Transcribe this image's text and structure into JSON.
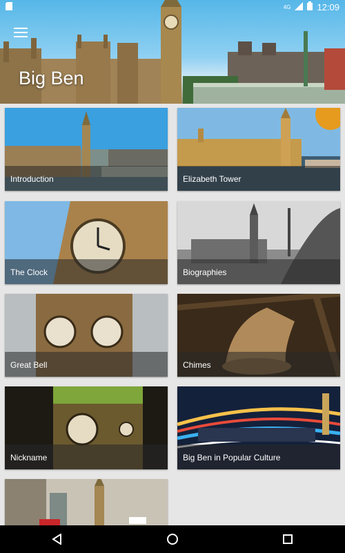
{
  "status": {
    "time": "12:09",
    "network": "4G"
  },
  "app": {
    "title": "Big Ben"
  },
  "cards": [
    {
      "label": "Introduction"
    },
    {
      "label": "Elizabeth Tower"
    },
    {
      "label": "The Clock"
    },
    {
      "label": "Biographies"
    },
    {
      "label": "Great Bell"
    },
    {
      "label": "Chimes"
    },
    {
      "label": "Nickname"
    },
    {
      "label": "Big Ben in Popular Culture"
    }
  ]
}
